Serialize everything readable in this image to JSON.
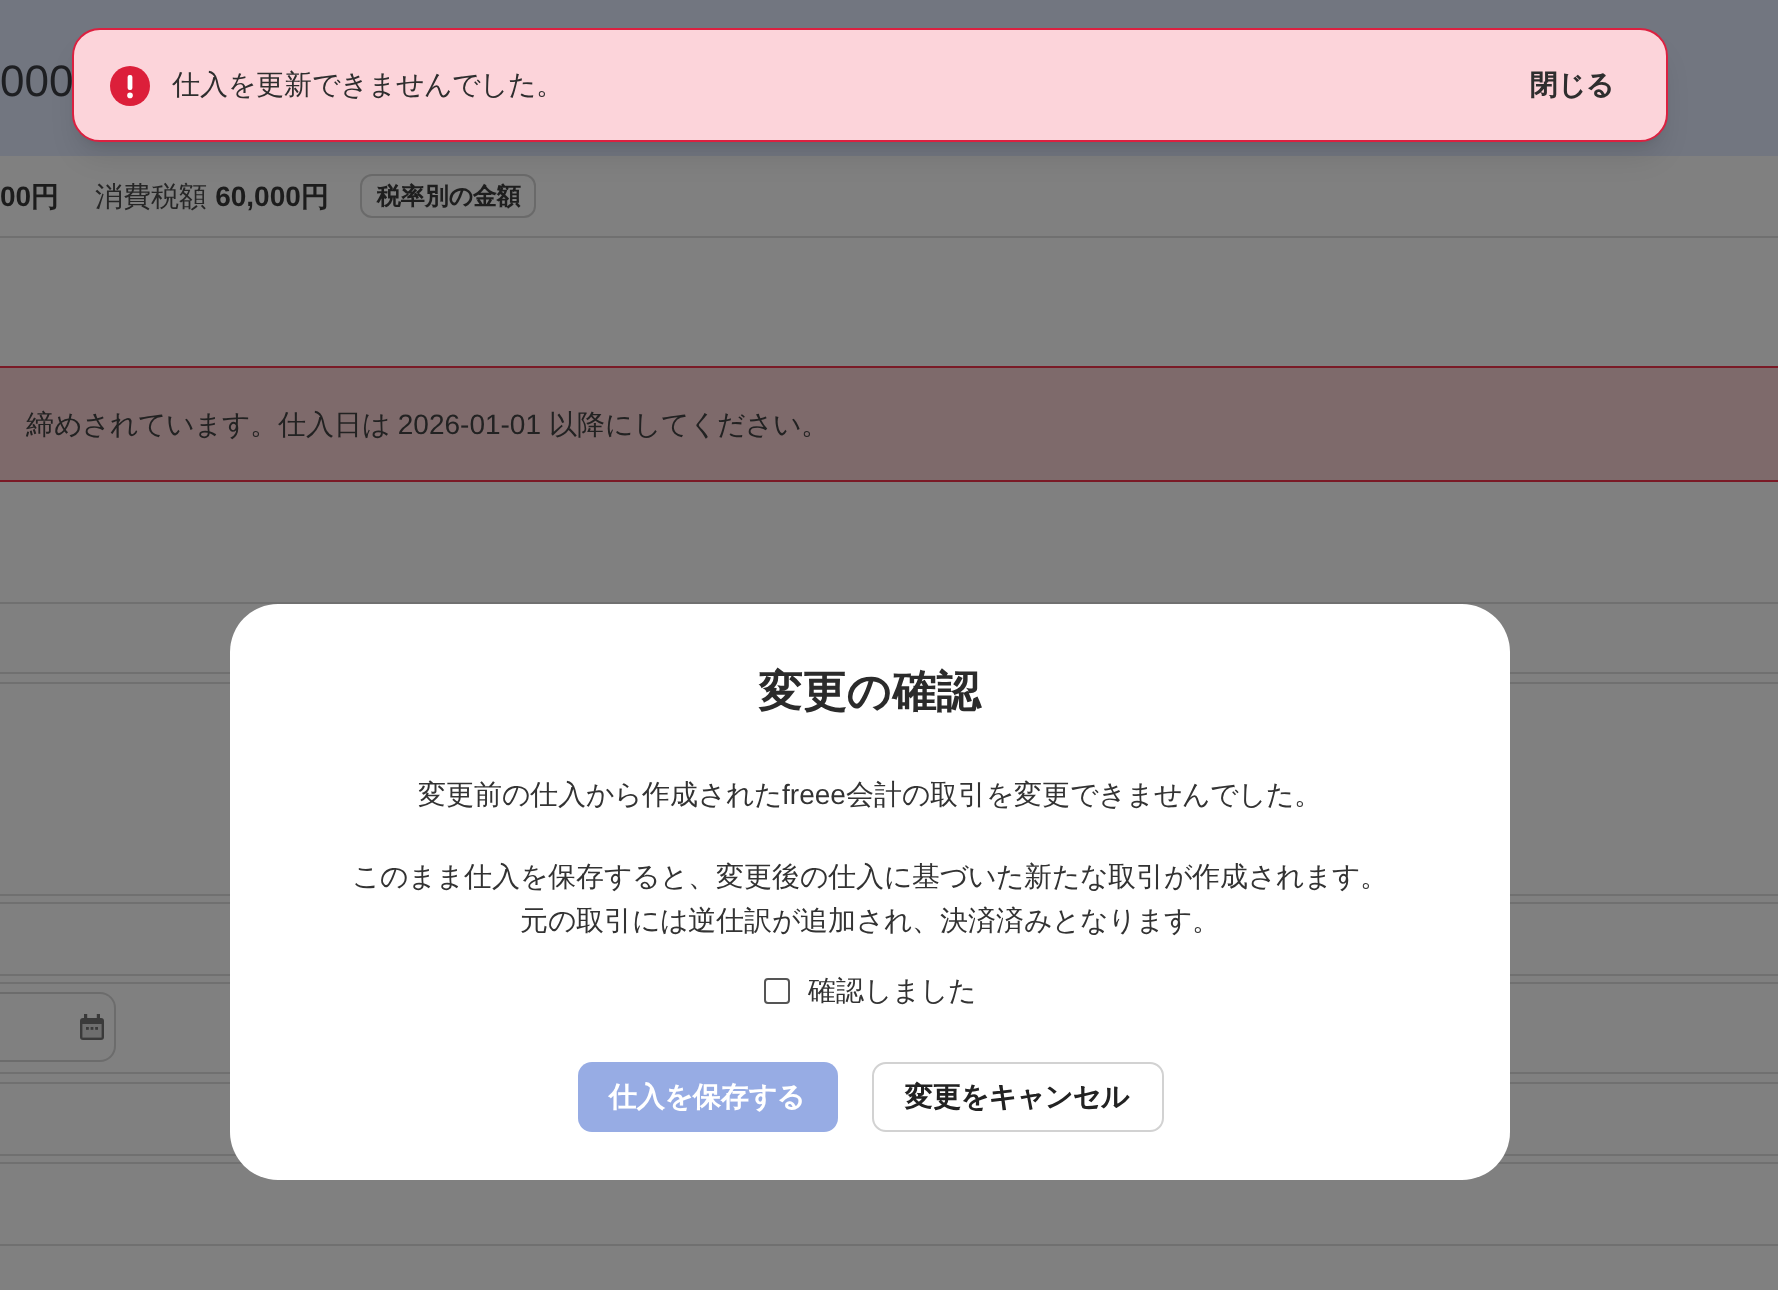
{
  "header": {
    "amount_fragment": "000"
  },
  "summary": {
    "total_fragment": "00円",
    "tax_label": "消費税額",
    "tax_amount": "60,000円",
    "tax_rate_button": "税率別の金額"
  },
  "closing_banner": {
    "message": "締めされています。仕入日は 2026-01-01 以降にしてください。"
  },
  "toast": {
    "message": "仕入を更新できませんでした。",
    "close_label": "閉じる"
  },
  "dialog": {
    "title": "変更の確認",
    "paragraphs": [
      [
        "変更前の仕入から作成されたfreee会計の取引を変更できませんでした。"
      ],
      [
        "このまま仕入を保存すると、変更後の仕入に基づいた新たな取引が作成されます。",
        "元の取引には逆仕訳が追加され、決済済みとなります。"
      ]
    ],
    "confirm_checkbox": {
      "label": "確認しました",
      "checked": false
    },
    "buttons": [
      {
        "label": "仕入を保存する",
        "kind": "primary",
        "disabled": true
      },
      {
        "label": "変更をキャンセル",
        "kind": "secondary",
        "disabled": false
      }
    ]
  }
}
